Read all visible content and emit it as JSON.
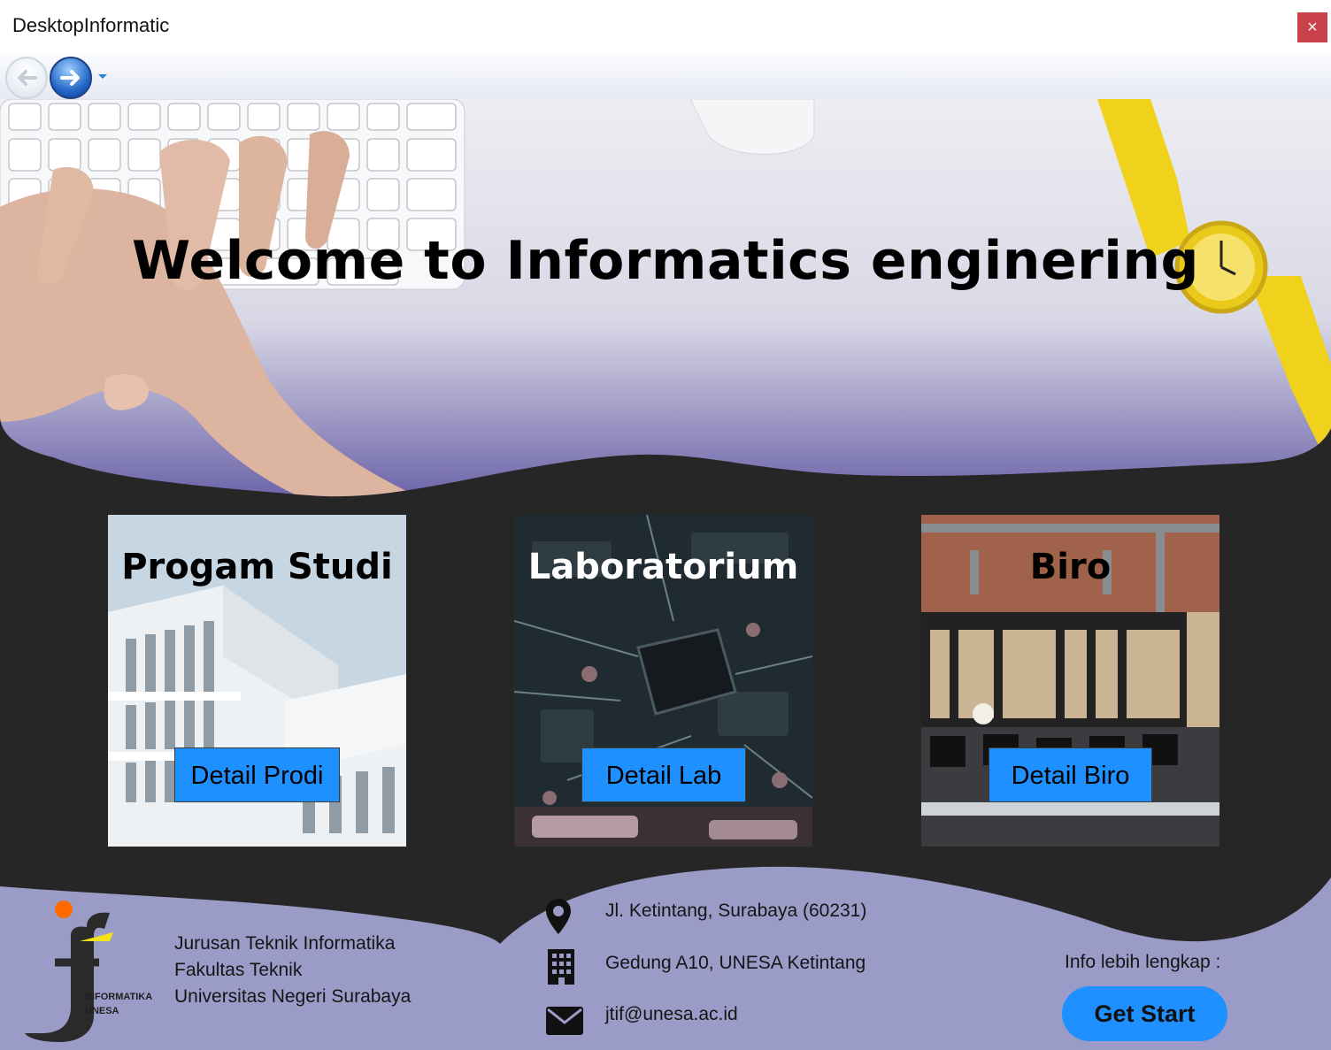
{
  "window": {
    "title": "DesktopInformatic",
    "close_glyph": "×"
  },
  "navigation": {
    "back_icon": "back-arrow-icon",
    "forward_icon": "forward-arrow-icon",
    "history_icon": "dropdown-arrow-icon"
  },
  "hero": {
    "title": "Welcome to Informatics enginering"
  },
  "cards": [
    {
      "title": "Progam Studi",
      "button": "Detail Prodi",
      "title_color": "#000000"
    },
    {
      "title": "Laboratorium",
      "button": "Detail Lab",
      "title_color": "#ffffff"
    },
    {
      "title": "Biro",
      "button": "Detail Biro",
      "title_color": "#000000"
    }
  ],
  "footer": {
    "logo_text": [
      "INFORMATIKA",
      "UNESA"
    ],
    "org_lines": [
      "Jurusan Teknik Informatika",
      "Fakultas Teknik",
      "Universitas Negeri Surabaya"
    ],
    "address": "Jl. Ketintang, Surabaya (60231)",
    "building": "Gedung A10, UNESA Ketintang",
    "email": "jtif@unesa.ac.id",
    "info_label": "Info lebih lengkap :",
    "cta_label": "Get Start"
  },
  "colors": {
    "accent": "#1e90ff",
    "background": "#262626",
    "footer": "#9b9bc7",
    "close": "#c8414b"
  }
}
